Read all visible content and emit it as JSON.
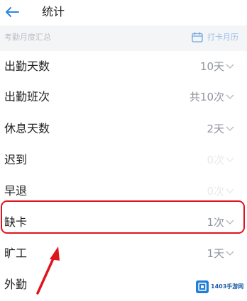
{
  "header": {
    "title": "统计",
    "back_icon": "arrow-left-icon"
  },
  "summary": {
    "label": "考勤月度汇总",
    "calendar_label": "打卡月历",
    "calendar_icon": "calendar-icon"
  },
  "rows": [
    {
      "label": "出勤天数",
      "value": "10天"
    },
    {
      "label": "出勤班次",
      "value": "共10次"
    },
    {
      "label": "休息天数",
      "value": "2天"
    },
    {
      "label": "迟到",
      "value": "0次"
    },
    {
      "label": "早退",
      "value": "0次"
    },
    {
      "label": "缺卡",
      "value": "1次"
    },
    {
      "label": "旷工",
      "value": "1天"
    },
    {
      "label": "外勤",
      "value": ""
    }
  ],
  "watermark": {
    "text": "1403手游网"
  },
  "colors": {
    "accent": "#2b86e6",
    "highlight": "#e0141c",
    "divider": "#f4f5f7"
  }
}
